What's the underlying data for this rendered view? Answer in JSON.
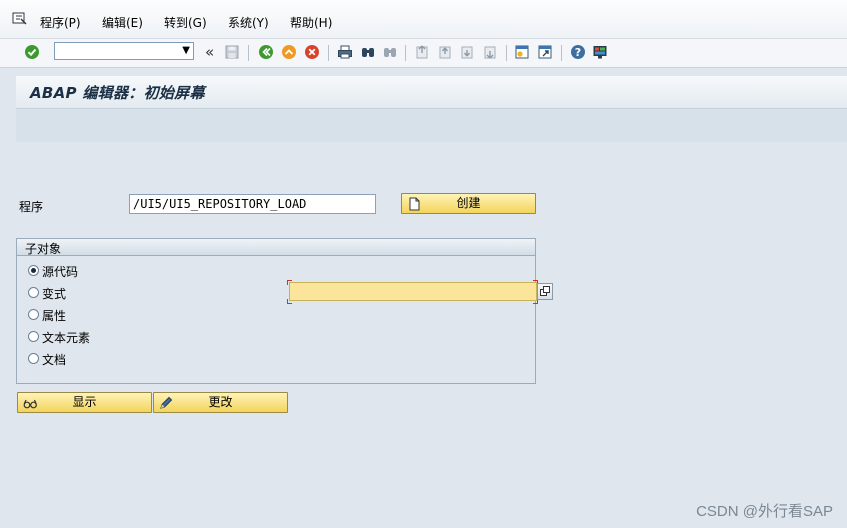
{
  "menubar": {
    "items": [
      "程序(P)",
      "编辑(E)",
      "转到(G)",
      "系统(Y)",
      "帮助(H)"
    ]
  },
  "toolbar": {
    "command_value": "",
    "dropdown_glyph": "▼",
    "back_glyph": "«"
  },
  "title": "ABAP 编辑器：初始屏幕",
  "form": {
    "program_label": "程序",
    "program_value": "/UI5/UI5_REPOSITORY_LOAD",
    "create_label": "创建",
    "subobjects_title": "子对象",
    "subobjects": [
      {
        "label": "源代码",
        "selected": true
      },
      {
        "label": "变式",
        "selected": false
      },
      {
        "label": "属性",
        "selected": false
      },
      {
        "label": "文本元素",
        "selected": false
      },
      {
        "label": "文档",
        "selected": false
      }
    ],
    "variant_value": "",
    "display_label": "显示",
    "change_label": "更改"
  },
  "watermark": "CSDN @外行看SAP",
  "colors": {
    "button_top": "#fff3b8",
    "button_bottom": "#f3d45c",
    "required_field": "#fbe59a",
    "background": "#dfe6ed",
    "enter_green": "#3c9a2e",
    "cancel_red": "#d6452b"
  }
}
